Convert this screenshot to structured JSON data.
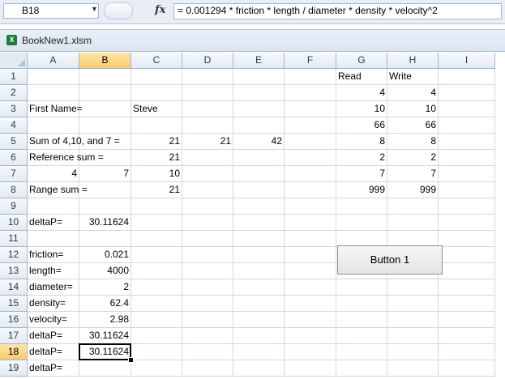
{
  "formula_bar": {
    "name_box": "B18",
    "fx_label": "fx",
    "formula": "= 0.001294 * friction * length / diameter * density * velocity^2"
  },
  "workbook": {
    "title": "BookNew1.xlsm",
    "icon": "excel-icon"
  },
  "columns": [
    "A",
    "B",
    "C",
    "D",
    "E",
    "F",
    "G",
    "H",
    "I"
  ],
  "rows": [
    "1",
    "2",
    "3",
    "4",
    "5",
    "6",
    "7",
    "8",
    "9",
    "10",
    "11",
    "12",
    "13",
    "14",
    "15",
    "16",
    "17",
    "18",
    "19"
  ],
  "selected_cell": {
    "column": "B",
    "row": "18"
  },
  "cells": {
    "G1": "Read",
    "H1": "Write",
    "G2": "4",
    "H2": "4",
    "A3": "First Name=",
    "C3": "Steve",
    "G3": "10",
    "H3": "10",
    "G4": "66",
    "H4": "66",
    "A5": "Sum of 4,10, and 7 =",
    "C5": "21",
    "D5": "21",
    "E5": "42",
    "G5": "8",
    "H5": "8",
    "A6": "Reference sum =",
    "C6": "21",
    "G6": "2",
    "H6": "2",
    "A7": "4",
    "B7": "7",
    "C7": "10",
    "G7": "7",
    "H7": "7",
    "A8": "Range sum =",
    "C8": "21",
    "G8": "999",
    "H8": "999",
    "A10": "deltaP=",
    "B10": "30.11624",
    "A12": "friction=",
    "B12": "0.021",
    "A13": "length=",
    "B13": "4000",
    "A14": "diameter=",
    "B14": "2",
    "A15": "density=",
    "B15": "62.4",
    "A16": "velocity=",
    "B16": "2.98",
    "A17": "deltaP=",
    "B17": "30.11624",
    "A18": "deltaP=",
    "B18": "30.11624",
    "A19": "deltaP="
  },
  "numeric_cells": [
    "G2",
    "H2",
    "G3",
    "H3",
    "G4",
    "H4",
    "C5",
    "D5",
    "E5",
    "G5",
    "H5",
    "C6",
    "G6",
    "H6",
    "A7",
    "B7",
    "C7",
    "G7",
    "H7",
    "C8",
    "G8",
    "H8",
    "B10",
    "B12",
    "B13",
    "B14",
    "B15",
    "B16",
    "B17",
    "B18"
  ],
  "button1": {
    "label": "Button 1"
  }
}
